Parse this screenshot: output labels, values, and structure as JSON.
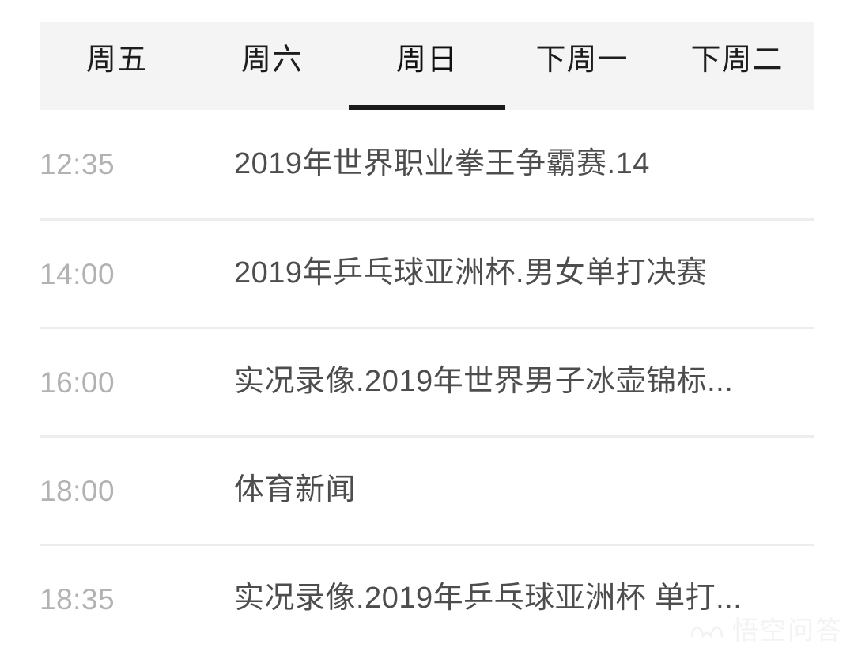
{
  "tabs": {
    "items": [
      {
        "label": "周五",
        "active": false
      },
      {
        "label": "周六",
        "active": false
      },
      {
        "label": "周日",
        "active": true
      },
      {
        "label": "下周一",
        "active": false
      },
      {
        "label": "下周二",
        "active": false
      }
    ]
  },
  "schedule": {
    "rows": [
      {
        "time": "12:35",
        "title": "2019年世界职业拳王争霸赛.14"
      },
      {
        "time": "14:00",
        "title": "2019年乒乓球亚洲杯.男女单打决赛"
      },
      {
        "time": "16:00",
        "title": "实况录像.2019年世界男子冰壶锦标..."
      },
      {
        "time": "18:00",
        "title": "体育新闻"
      },
      {
        "time": "18:35",
        "title": "实况录像.2019年乒乓球亚洲杯 单打..."
      }
    ]
  },
  "watermark": {
    "text": "悟空问答",
    "icon": "wukong-logo-icon"
  },
  "colors": {
    "page_background": "#ffffff",
    "tabbar_background": "#f4f4f4",
    "tab_active_underline": "#1a1a1a",
    "tab_label": "#1d1d1d",
    "row_time": "#b2b2b2",
    "row_title": "#4d4d4d",
    "row_divider": "#ededed",
    "watermark": "#d9d9d9"
  }
}
